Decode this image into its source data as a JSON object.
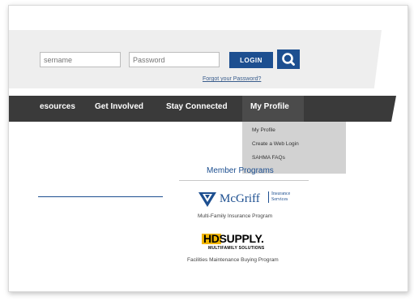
{
  "login": {
    "username_placeholder": "sername",
    "password_placeholder": "Password",
    "login_label": "LOGIN",
    "forgot_label": "Forgot your Password?"
  },
  "nav": {
    "items": [
      {
        "label": "esources"
      },
      {
        "label": "Get Involved"
      },
      {
        "label": "Stay Connected"
      },
      {
        "label": "My Profile"
      }
    ],
    "dropdown": [
      {
        "label": "My Profile"
      },
      {
        "label": "Create a Web Login"
      },
      {
        "label": "SAHMA FAQs"
      }
    ]
  },
  "members": {
    "heading": "Member Programs",
    "mcgriff_name": "McGriff",
    "mcgriff_sub1": "Insurance",
    "mcgriff_sub2": "Services",
    "mcgriff_caption": "Multi-Family Insurance Program",
    "hd_name": "HDSUPPLY.",
    "hd_sub": "MULTIFAMILY SOLUTIONS",
    "hd_caption": "Facilities Maintenance Buying Program"
  },
  "colors": {
    "brand_blue": "#1d4f90",
    "nav_dark": "#3a3a3a",
    "hd_yellow": "#f2b600"
  },
  "icons": {
    "search": "search-icon",
    "mcgriff": "mcgriff-shield-icon"
  }
}
